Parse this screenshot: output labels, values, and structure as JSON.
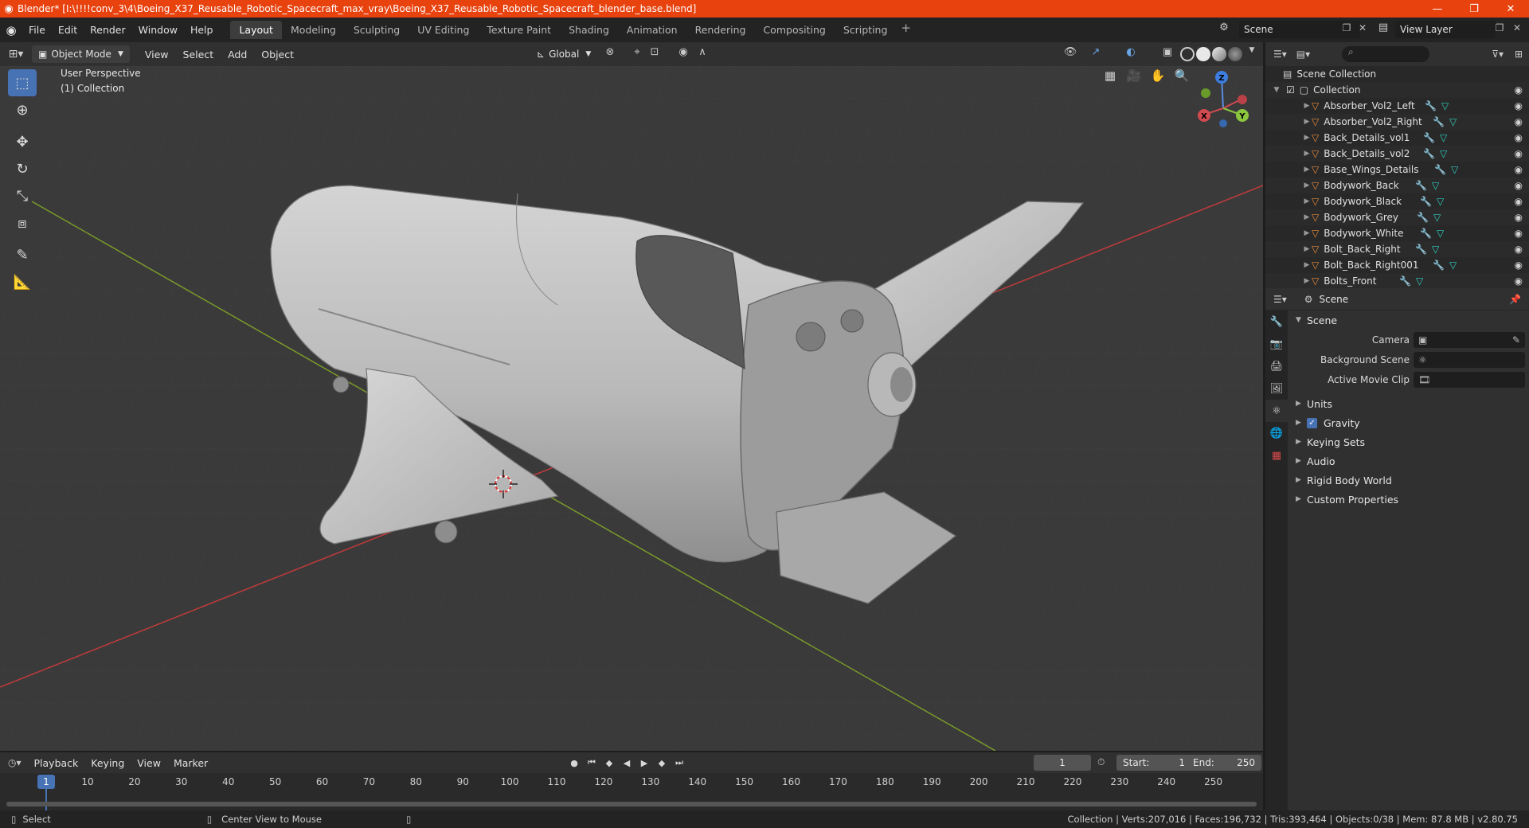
{
  "window": {
    "title": "Blender* [I:\\!!!!conv_3\\4\\Boeing_X37_Reusable_Robotic_Spacecraft_max_vray\\Boeing_X37_Reusable_Robotic_Spacecraft_blender_base.blend]",
    "minimize": "—",
    "maximize": "❐",
    "close": "✕"
  },
  "menu": {
    "items": [
      "File",
      "Edit",
      "Render",
      "Window",
      "Help"
    ]
  },
  "workspaces": [
    "Layout",
    "Modeling",
    "Sculpting",
    "UV Editing",
    "Texture Paint",
    "Shading",
    "Animation",
    "Rendering",
    "Compositing",
    "Scripting"
  ],
  "active_workspace": "Layout",
  "scene": {
    "name": "Scene",
    "view_layer": "View Layer"
  },
  "viewport_header": {
    "mode": "Object Mode",
    "menus": [
      "View",
      "Select",
      "Add",
      "Object"
    ],
    "transform": "Global"
  },
  "viewport": {
    "perspective": "User Perspective",
    "collection": "(1) Collection",
    "gizmo": {
      "x": "X",
      "y": "Y",
      "z": "Z"
    }
  },
  "outliner": {
    "root": "Scene Collection",
    "collection": "Collection",
    "objects": [
      "Absorber_Vol2_Left",
      "Absorber_Vol2_Right",
      "Back_Details_vol1",
      "Back_Details_vol2",
      "Base_Wings_Details",
      "Bodywork_Back",
      "Bodywork_Black",
      "Bodywork_Grey",
      "Bodywork_White",
      "Bolt_Back_Right",
      "Bolt_Back_Right001",
      "Bolts_Front"
    ]
  },
  "properties": {
    "context": "Scene",
    "panel": "Scene",
    "fields": [
      {
        "label": "Camera"
      },
      {
        "label": "Background Scene"
      },
      {
        "label": "Active Movie Clip"
      }
    ],
    "subpanels": [
      "Units",
      "Gravity",
      "Keying Sets",
      "Audio",
      "Rigid Body World",
      "Custom Properties"
    ]
  },
  "timeline": {
    "menus": [
      "Playback",
      "Keying",
      "View",
      "Marker"
    ],
    "current_frame": "1",
    "start_label": "Start:",
    "start": "1",
    "end_label": "End:",
    "end": "250",
    "ticks": [
      "1",
      "10",
      "20",
      "30",
      "40",
      "50",
      "60",
      "70",
      "80",
      "90",
      "100",
      "110",
      "120",
      "130",
      "140",
      "150",
      "160",
      "170",
      "180",
      "190",
      "200",
      "210",
      "220",
      "230",
      "240",
      "250"
    ]
  },
  "statusbar": {
    "select": "Select",
    "center_view": "Center View to Mouse",
    "stats": "Collection | Verts:207,016 | Faces:196,732 | Tris:393,464 | Objects:0/38 | Mem: 87.8 MB | v2.80.75"
  }
}
